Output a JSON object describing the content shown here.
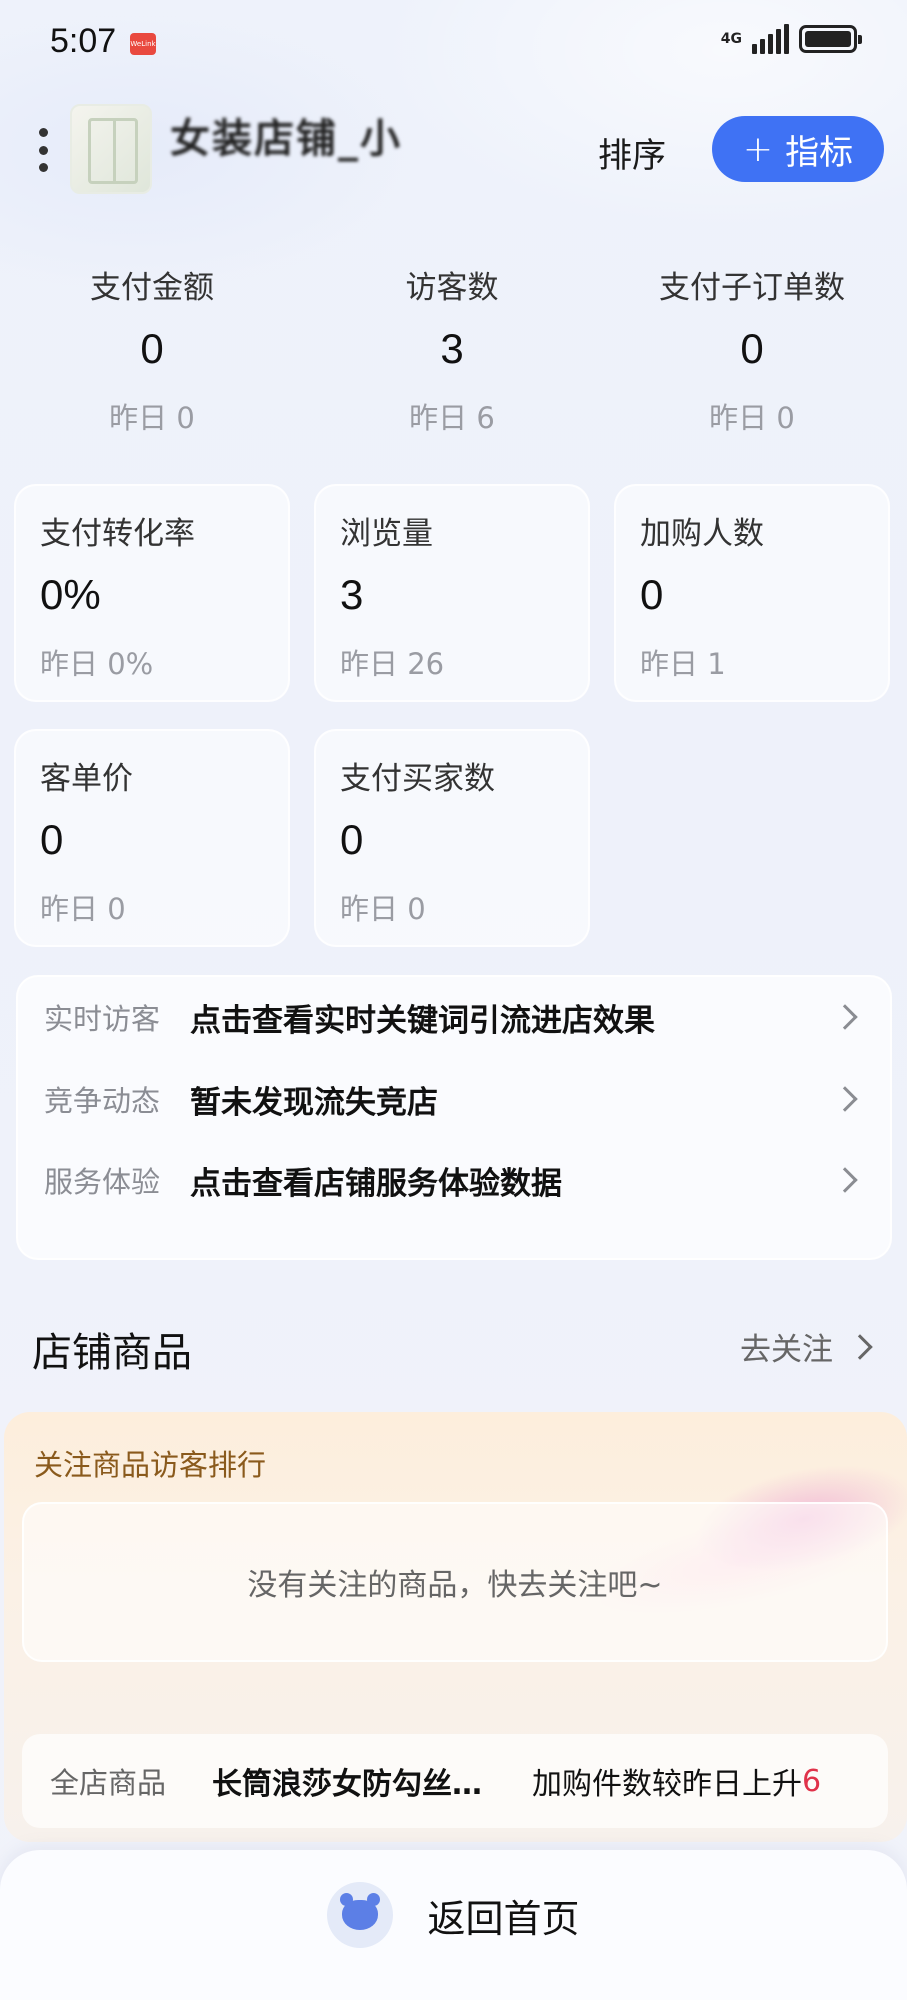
{
  "status_bar": {
    "time": "5:07",
    "app_badge": "WeLink",
    "network": "4G"
  },
  "header": {
    "shop_name": "女装店铺_小",
    "sort_label": "排序",
    "add_metric_plus": "+",
    "add_metric_label": "指标"
  },
  "top_metrics": [
    {
      "label": "支付金额",
      "value": "0",
      "yesterday": "昨日 0"
    },
    {
      "label": "访客数",
      "value": "3",
      "yesterday": "昨日 6"
    },
    {
      "label": "支付子订单数",
      "value": "0",
      "yesterday": "昨日 0"
    }
  ],
  "cards": [
    {
      "label": "支付转化率",
      "value": "0%",
      "yesterday": "昨日 0%"
    },
    {
      "label": "浏览量",
      "value": "3",
      "yesterday": "昨日 26"
    },
    {
      "label": "加购人数",
      "value": "0",
      "yesterday": "昨日 1"
    },
    {
      "label": "客单价",
      "value": "0",
      "yesterday": "昨日 0"
    },
    {
      "label": "支付买家数",
      "value": "0",
      "yesterday": "昨日 0"
    }
  ],
  "info_rows": [
    {
      "tag": "实时访客",
      "text": "点击查看实时关键词引流进店效果"
    },
    {
      "tag": "竞争动态",
      "text": "暂未发现流失竞店"
    },
    {
      "tag": "服务体验",
      "text": "点击查看店铺服务体验数据"
    }
  ],
  "goods_section": {
    "title": "店铺商品",
    "follow_link": "去关注",
    "follow_rank_title": "关注商品访客排行",
    "empty_text": "没有关注的商品，快去关注吧~",
    "row_tag": "全店商品",
    "row_name": "长筒浪莎女防勾丝…",
    "row_desc": "加购件数较昨日上升",
    "row_num": "6"
  },
  "bottom": {
    "home_label": "返回首页"
  },
  "colors": {
    "accent": "#3f72f4",
    "highlight": "#e0324a"
  }
}
